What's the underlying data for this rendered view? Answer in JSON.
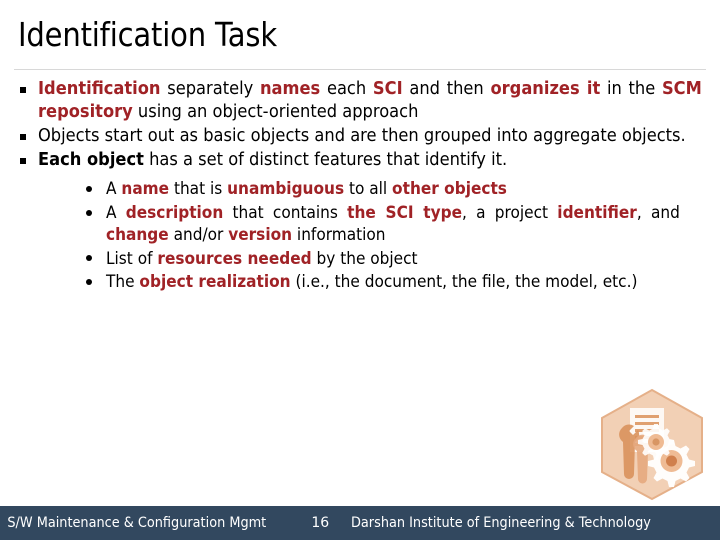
{
  "slide": {
    "title": "Identification Task",
    "background_color": "#FFFFFF",
    "accent_color": "#A02226",
    "footer_color": "#32485F"
  },
  "bullets": [
    {
      "marker": "square",
      "runs": [
        {
          "text": "Identification",
          "style": "accent"
        },
        {
          "text": " separately ",
          "style": "plain"
        },
        {
          "text": "names",
          "style": "accent"
        },
        {
          "text": " each ",
          "style": "plain"
        },
        {
          "text": "SCI",
          "style": "accent"
        },
        {
          "text": " and then ",
          "style": "plain"
        },
        {
          "text": "organizes it",
          "style": "accent"
        },
        {
          "text": " in the ",
          "style": "plain"
        },
        {
          "text": "SCM repository",
          "style": "accent"
        },
        {
          "text": " using an object-oriented approach",
          "style": "plain"
        }
      ]
    },
    {
      "marker": "square",
      "runs": [
        {
          "text": "Objects start out as basic objects and are then grouped into aggregate objects.",
          "style": "plain"
        }
      ]
    },
    {
      "marker": "square",
      "runs": [
        {
          "text": "Each object",
          "style": "bold-black"
        },
        {
          "text": " has a set of distinct features that identify it.",
          "style": "plain"
        }
      ]
    }
  ],
  "sub_bullets": [
    {
      "marker": "dot",
      "runs": [
        {
          "text": "A ",
          "style": "plain"
        },
        {
          "text": "name",
          "style": "accent"
        },
        {
          "text": " that is ",
          "style": "plain"
        },
        {
          "text": "unambiguous",
          "style": "accent"
        },
        {
          "text": " to all ",
          "style": "plain"
        },
        {
          "text": "other objects",
          "style": "accent"
        }
      ]
    },
    {
      "marker": "dot",
      "runs": [
        {
          "text": "A ",
          "style": "plain"
        },
        {
          "text": "description",
          "style": "accent"
        },
        {
          "text": " that contains ",
          "style": "plain"
        },
        {
          "text": "the SCI type",
          "style": "accent"
        },
        {
          "text": ", a project ",
          "style": "plain"
        },
        {
          "text": "identifier",
          "style": "accent"
        },
        {
          "text": ", and ",
          "style": "plain"
        },
        {
          "text": "change",
          "style": "accent"
        },
        {
          "text": " and/or ",
          "style": "plain"
        },
        {
          "text": "version",
          "style": "accent"
        },
        {
          "text": " information",
          "style": "plain"
        }
      ]
    },
    {
      "marker": "dot",
      "runs": [
        {
          "text": "List of ",
          "style": "plain"
        },
        {
          "text": "resources needed",
          "style": "accent"
        },
        {
          "text": " by the object",
          "style": "plain"
        }
      ]
    },
    {
      "marker": "dot",
      "runs": [
        {
          "text": "The ",
          "style": "plain"
        },
        {
          "text": "object realization",
          "style": "accent"
        },
        {
          "text": " (i.e., the document, the file, the model, etc.)",
          "style": "plain"
        }
      ]
    }
  ],
  "watermark": {
    "name": "maintenance-hexagon-icon",
    "description": "hexagon with wrench, document and gears",
    "color": "#E8A878"
  },
  "footer": {
    "left": "S/W Maintenance & Configuration Mgmt",
    "page": "16",
    "right": "Darshan Institute of Engineering & Technology"
  }
}
